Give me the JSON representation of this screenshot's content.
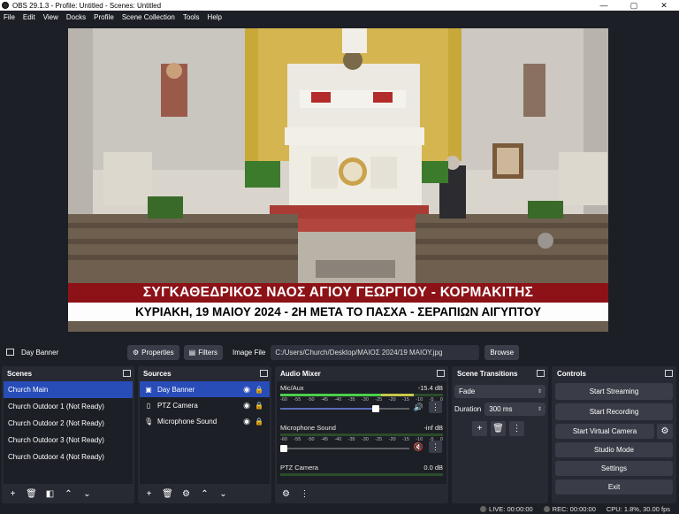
{
  "window": {
    "title": "OBS 29.1.3 - Profile: Untitled - Scenes: Untitled",
    "minimize": "—",
    "maximize": "▢",
    "close": "✕"
  },
  "menu": [
    "File",
    "Edit",
    "View",
    "Docks",
    "Profile",
    "Scene Collection",
    "Tools",
    "Help"
  ],
  "preview": {
    "banner_line1": "ΣΥΓΚΑΘΕΔΡΙΚΟΣ ΝΑΟΣ ΑΓΙΟΥ ΓΕΩΡΓΙΟΥ - ΚΟΡΜΑΚΙΤΗΣ",
    "banner_line2": "ΚΥΡΙΑΚΗ, 19 ΜΑΙΟΥ 2024 - 2Η ΜΕΤΑ ΤΟ ΠΑΣΧΑ - ΣΕΡΑΠΙΩΝ ΑΙΓΥΠΤΟΥ",
    "banner_color": "#8d1217"
  },
  "source_toolbar": {
    "source_name": "Day Banner",
    "properties_label": "Properties",
    "filters_label": "Filters",
    "image_file_label": "Image File",
    "image_path": "C:/Users/Church/Desktop/ΜΑΙΟΣ 2024/19 ΜΑΙΟΥ.jpg",
    "browse_label": "Browse"
  },
  "scenes": {
    "title": "Scenes",
    "items": [
      "Church Main",
      "Church Outdoor 1 (Not Ready)",
      "Church Outdoor 2 (Not Ready)",
      "Church Outdoor 3 (Not Ready)",
      "Church Outdoor 4 (Not Ready)"
    ],
    "selected_index": 0
  },
  "sources": {
    "title": "Sources",
    "items": [
      {
        "name": "Day Banner",
        "icon": "image-icon"
      },
      {
        "name": "PTZ Camera",
        "icon": "document-icon"
      },
      {
        "name": "Microphone Sound",
        "icon": "microphone-icon"
      }
    ],
    "selected_index": 0
  },
  "audio_mixer": {
    "title": "Audio Mixer",
    "channels": [
      {
        "name": "Mic/Aux",
        "level": "-15.4 dB",
        "volume": 0.73,
        "muted": false
      },
      {
        "name": "Microphone Sound",
        "level": "-inf dB",
        "volume": 0.05,
        "muted": true
      },
      {
        "name": "PTZ Camera",
        "level": "0.0 dB"
      }
    ],
    "ticks": [
      "-60",
      "-55",
      "-50",
      "-45",
      "-40",
      "-35",
      "-30",
      "-25",
      "-20",
      "-15",
      "-10",
      "-5",
      "0"
    ]
  },
  "scene_transitions": {
    "title": "Scene Transitions",
    "transition": "Fade",
    "duration_label": "Duration",
    "duration_value": "300 ms"
  },
  "controls": {
    "title": "Controls",
    "start_streaming": "Start Streaming",
    "start_recording": "Start Recording",
    "start_virtual_camera": "Start Virtual Camera",
    "studio_mode": "Studio Mode",
    "settings": "Settings",
    "exit": "Exit"
  },
  "status": {
    "live": "LIVE: 00:00:00",
    "rec": "REC: 00:00:00",
    "cpu": "CPU: 1.8%, 30.00 fps"
  }
}
